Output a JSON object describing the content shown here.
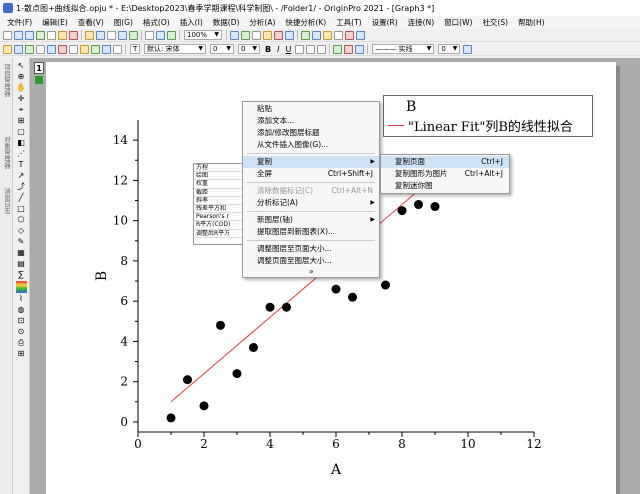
{
  "titlebar": {
    "title": "1-散点图+曲线拟合.opju * - E:\\Desktop2023\\春季学期课程\\科学制图\\ - /Folder1/ - OriginPro 2021 - [Graph3 *]"
  },
  "menu": [
    "文件(F)",
    "编辑(E)",
    "查看(V)",
    "图(G)",
    "格式(O)",
    "插入(I)",
    "数据(D)",
    "分析(A)",
    "快捷分析(K)",
    "工具(T)",
    "设置(R)",
    "连接(N)",
    "窗口(W)",
    "社交(S)",
    "帮助(H)"
  ],
  "toolbar": {
    "zoom": "100%",
    "font_hint": "默认: 宋体",
    "font_size_1": "0",
    "font_size_2": "0",
    "bold": "B",
    "italic": "I",
    "underline": "U",
    "line_style": "——— 实线",
    "line_width": "0"
  },
  "left_panel": {
    "project_label": "项目管理器",
    "object_label": "对象管理器",
    "message_label": "消息日志"
  },
  "layer": {
    "number": "1"
  },
  "chart_data": {
    "type": "scatter",
    "xlabel": "A",
    "ylabel": "B",
    "xlim": [
      0,
      12
    ],
    "ylim": [
      -0.5,
      15
    ],
    "xticks": [
      0,
      2,
      4,
      6,
      8,
      10,
      12
    ],
    "yticks": [
      0,
      2,
      4,
      6,
      8,
      10,
      12,
      14
    ],
    "x": [
      1,
      1.5,
      2,
      2.5,
      3,
      3.5,
      4,
      4.5,
      6,
      6.5,
      7.5,
      8,
      8.5,
      9,
      9.5
    ],
    "y": [
      0.2,
      2.1,
      0.8,
      4.8,
      2.4,
      3.7,
      5.7,
      5.7,
      6.6,
      6.2,
      6.8,
      10.5,
      10.8,
      10.7,
      13
    ],
    "fit_line": {
      "x": [
        1,
        9.5
      ],
      "y": [
        1.0,
        12.9
      ]
    },
    "marker_color": "#000000",
    "fit_color": "#e04040",
    "grid": false
  },
  "legend": {
    "series": "B",
    "fit": "\"Linear Fit\"列B的线性拟合"
  },
  "stats_table": [
    "方程",
    "绘图",
    "权重",
    "截距",
    "斜率",
    "残差平方和",
    "Pearson's r",
    "R平方(COD)",
    "调整后R平方"
  ],
  "context_menu": {
    "items": [
      {
        "label": "粘贴",
        "shortcut": "",
        "disabled": false
      },
      {
        "label": "添加文本...",
        "shortcut": "",
        "disabled": false
      },
      {
        "label": "添加/修改图层标题",
        "shortcut": "",
        "disabled": false
      },
      {
        "label": "从文件插入图像(G)...",
        "shortcut": "",
        "disabled": false
      },
      {
        "label": "复制",
        "shortcut": "",
        "disabled": false
      },
      {
        "label": "全屏",
        "shortcut": "Ctrl+Shift+J",
        "disabled": false
      },
      {
        "label": "清除数据标记(C)",
        "shortcut": "Ctrl+Alt+N",
        "disabled": true
      },
      {
        "label": "分析标记(A)",
        "shortcut": "",
        "disabled": false
      },
      {
        "label": "新图层(轴)",
        "shortcut": "",
        "disabled": false
      },
      {
        "label": "提取图层到新图表(X)...",
        "shortcut": "",
        "disabled": false
      },
      {
        "label": "调整图层至页面大小...",
        "shortcut": "",
        "disabled": false
      },
      {
        "label": "调整页面至图层大小...",
        "shortcut": "",
        "disabled": false
      }
    ],
    "more": "»"
  },
  "submenu": {
    "items": [
      {
        "label": "复制页面",
        "shortcut": "Ctrl+J"
      },
      {
        "label": "复制图形为图片",
        "shortcut": "Ctrl+Alt+J"
      },
      {
        "label": "复制迷你图",
        "shortcut": ""
      }
    ]
  }
}
